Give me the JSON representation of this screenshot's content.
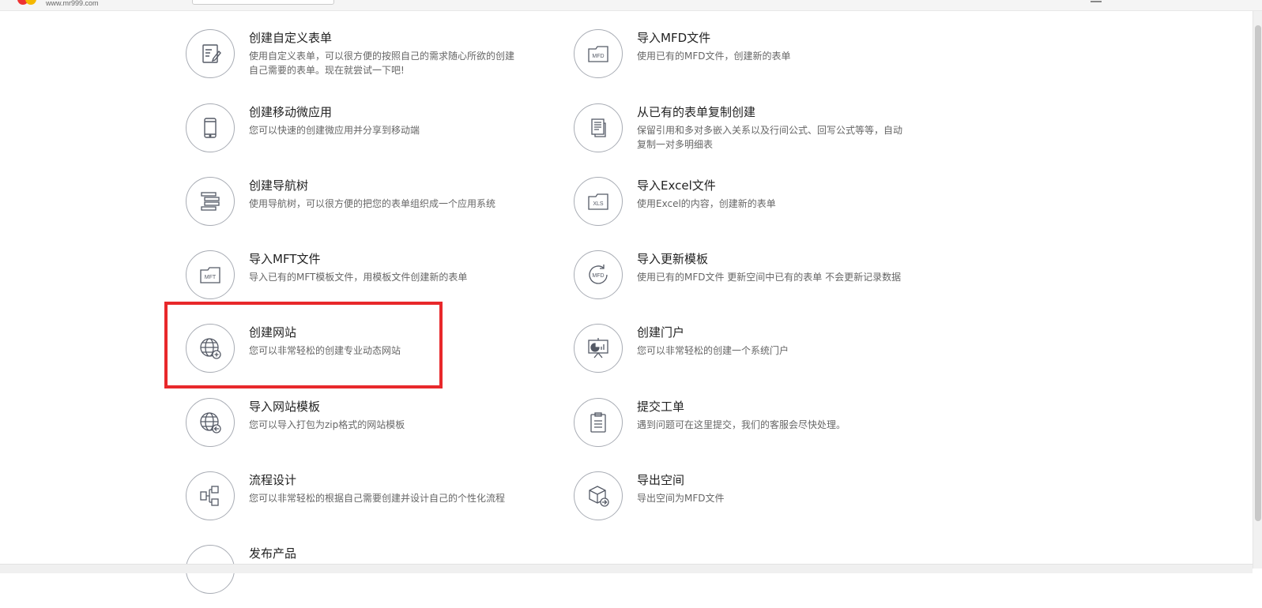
{
  "header": {
    "logo_text": "www.mr999.com"
  },
  "items": [
    {
      "title": "创建自定义表单",
      "desc": "使用自定义表单，可以很方便的按照自己的需求随心所欲的创建自己需要的表单。现在就尝试一下吧!",
      "icon": "form-edit-icon"
    },
    {
      "title": "导入MFD文件",
      "desc": "使用已有的MFD文件，创建新的表单",
      "icon": "mfd-folder-icon"
    },
    {
      "title": "创建移动微应用",
      "desc": "您可以快速的创建微应用并分享到移动端",
      "icon": "mobile-phone-icon"
    },
    {
      "title": "从已有的表单复制创建",
      "desc": "保留引用和多对多嵌入关系以及行间公式、回写公式等等，自动复制一对多明细表",
      "icon": "copy-document-icon"
    },
    {
      "title": "创建导航树",
      "desc": "使用导航树，可以很方便的把您的表单组织成一个应用系统",
      "icon": "navigation-tree-icon"
    },
    {
      "title": "导入Excel文件",
      "desc": "使用Excel的内容，创建新的表单",
      "icon": "xls-folder-icon"
    },
    {
      "title": "导入MFT文件",
      "desc": "导入已有的MFT模板文件，用模板文件创建新的表单",
      "icon": "mft-folder-icon"
    },
    {
      "title": "导入更新模板",
      "desc": "使用已有的MFD文件 更新空间中已有的表单 不会更新记录数据",
      "icon": "mfd-refresh-icon"
    },
    {
      "title": "创建网站",
      "desc": "您可以非常轻松的创建专业动态网站",
      "icon": "globe-add-icon"
    },
    {
      "title": "创建门户",
      "desc": "您可以非常轻松的创建一个系统门户",
      "icon": "presentation-board-icon"
    },
    {
      "title": "导入网站模板",
      "desc": "您可以导入打包为zip格式的网站模板",
      "icon": "globe-import-icon"
    },
    {
      "title": "提交工单",
      "desc": "遇到问题可在这里提交，我们的客服会尽快处理。",
      "icon": "clipboard-icon"
    },
    {
      "title": "流程设计",
      "desc": "您可以非常轻松的根据自己需要创建并设计自己的个性化流程",
      "icon": "flowchart-icon"
    },
    {
      "title": "导出空间",
      "desc": "导出空间为MFD文件",
      "icon": "cube-export-icon"
    },
    {
      "title": "发布产品",
      "desc": "",
      "icon": "publish-icon"
    }
  ],
  "colors": {
    "highlight": "#e8282b",
    "icon_stroke": "#555a66",
    "circle_border": "#a8acb4"
  }
}
